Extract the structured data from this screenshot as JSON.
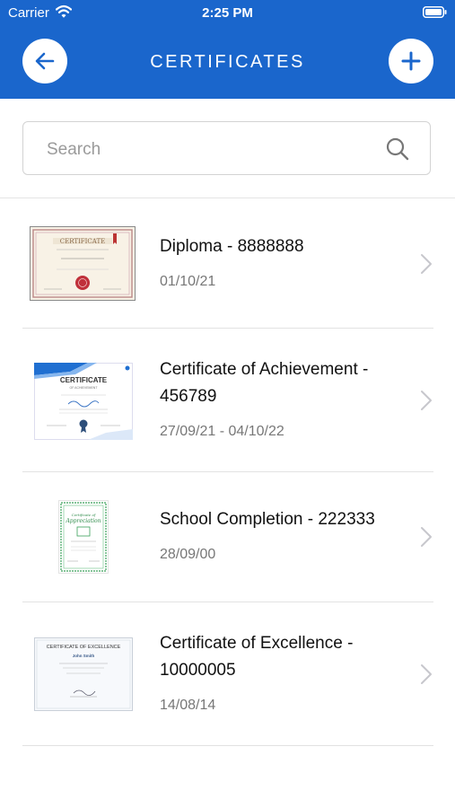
{
  "status": {
    "carrier": "Carrier",
    "time": "2:25 PM"
  },
  "header": {
    "title": "CERTIFICATES"
  },
  "search": {
    "placeholder": "Search"
  },
  "certificates": [
    {
      "title": "Diploma - 8888888",
      "date": "01/10/21"
    },
    {
      "title": "Certificate of Achievement  - 456789",
      "date": "27/09/21 - 04/10/22"
    },
    {
      "title": "School Completion - 222333",
      "date": "28/09/00"
    },
    {
      "title": "Certificate of Excellence - 10000005",
      "date": "14/08/14"
    }
  ],
  "colors": {
    "accent": "#1a66cc"
  }
}
